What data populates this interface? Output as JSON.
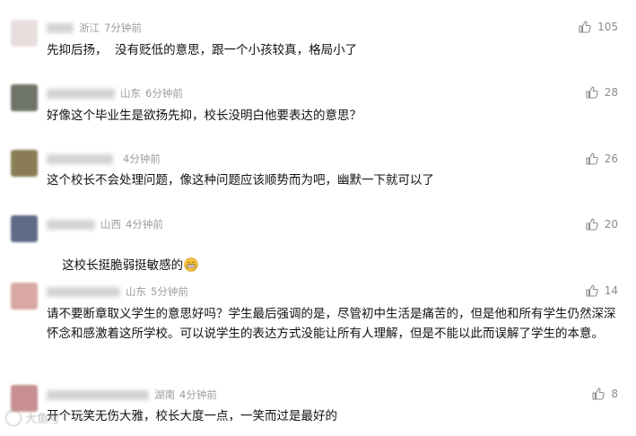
{
  "comments": [
    {
      "location": "浙江",
      "time": "7分钟前",
      "likes": "105",
      "text": "先抑后扬，  没有贬低的意思，跟一个小孩较真，格局小了",
      "avatar_color": "#e9dede"
    },
    {
      "location": "山东",
      "time": "6分钟前",
      "likes": "28",
      "text": "好像这个毕业生是欲扬先抑，校长没明白他要表达的意思？",
      "avatar_color": "#6f7468"
    },
    {
      "location": "",
      "time": "4分钟前",
      "likes": "26",
      "text": "这个校长不会处理问题，像这种问题应该顺势而为吧，幽默一下就可以了",
      "avatar_color": "#8a7d55"
    },
    {
      "location": "山西",
      "time": "4分钟前",
      "likes": "20",
      "text": "这校长挺脆弱挺敏感的",
      "avatar_color": "#5d6b84",
      "emoji": "grin-emoji"
    },
    {
      "location": "山东",
      "time": "5分钟前",
      "likes": "14",
      "text": "请不要断章取义学生的意思好吗？学生最后强调的是，尽管初中生活是痛苦的，但是他和所有学生仍然深深怀念和感激着这所学校。可以说学生的表达方式没能让所有人理解，但是不能以此而误解了学生的本意。",
      "avatar_color": "#d9a8a2"
    },
    {
      "location": "湖南",
      "time": "4分钟前",
      "likes": "8",
      "text": "开个玩笑无伤大雅，校长大度一点，一笑而过是最好的",
      "avatar_color": "#c78f8f"
    }
  ],
  "watermark": "大鱼号"
}
